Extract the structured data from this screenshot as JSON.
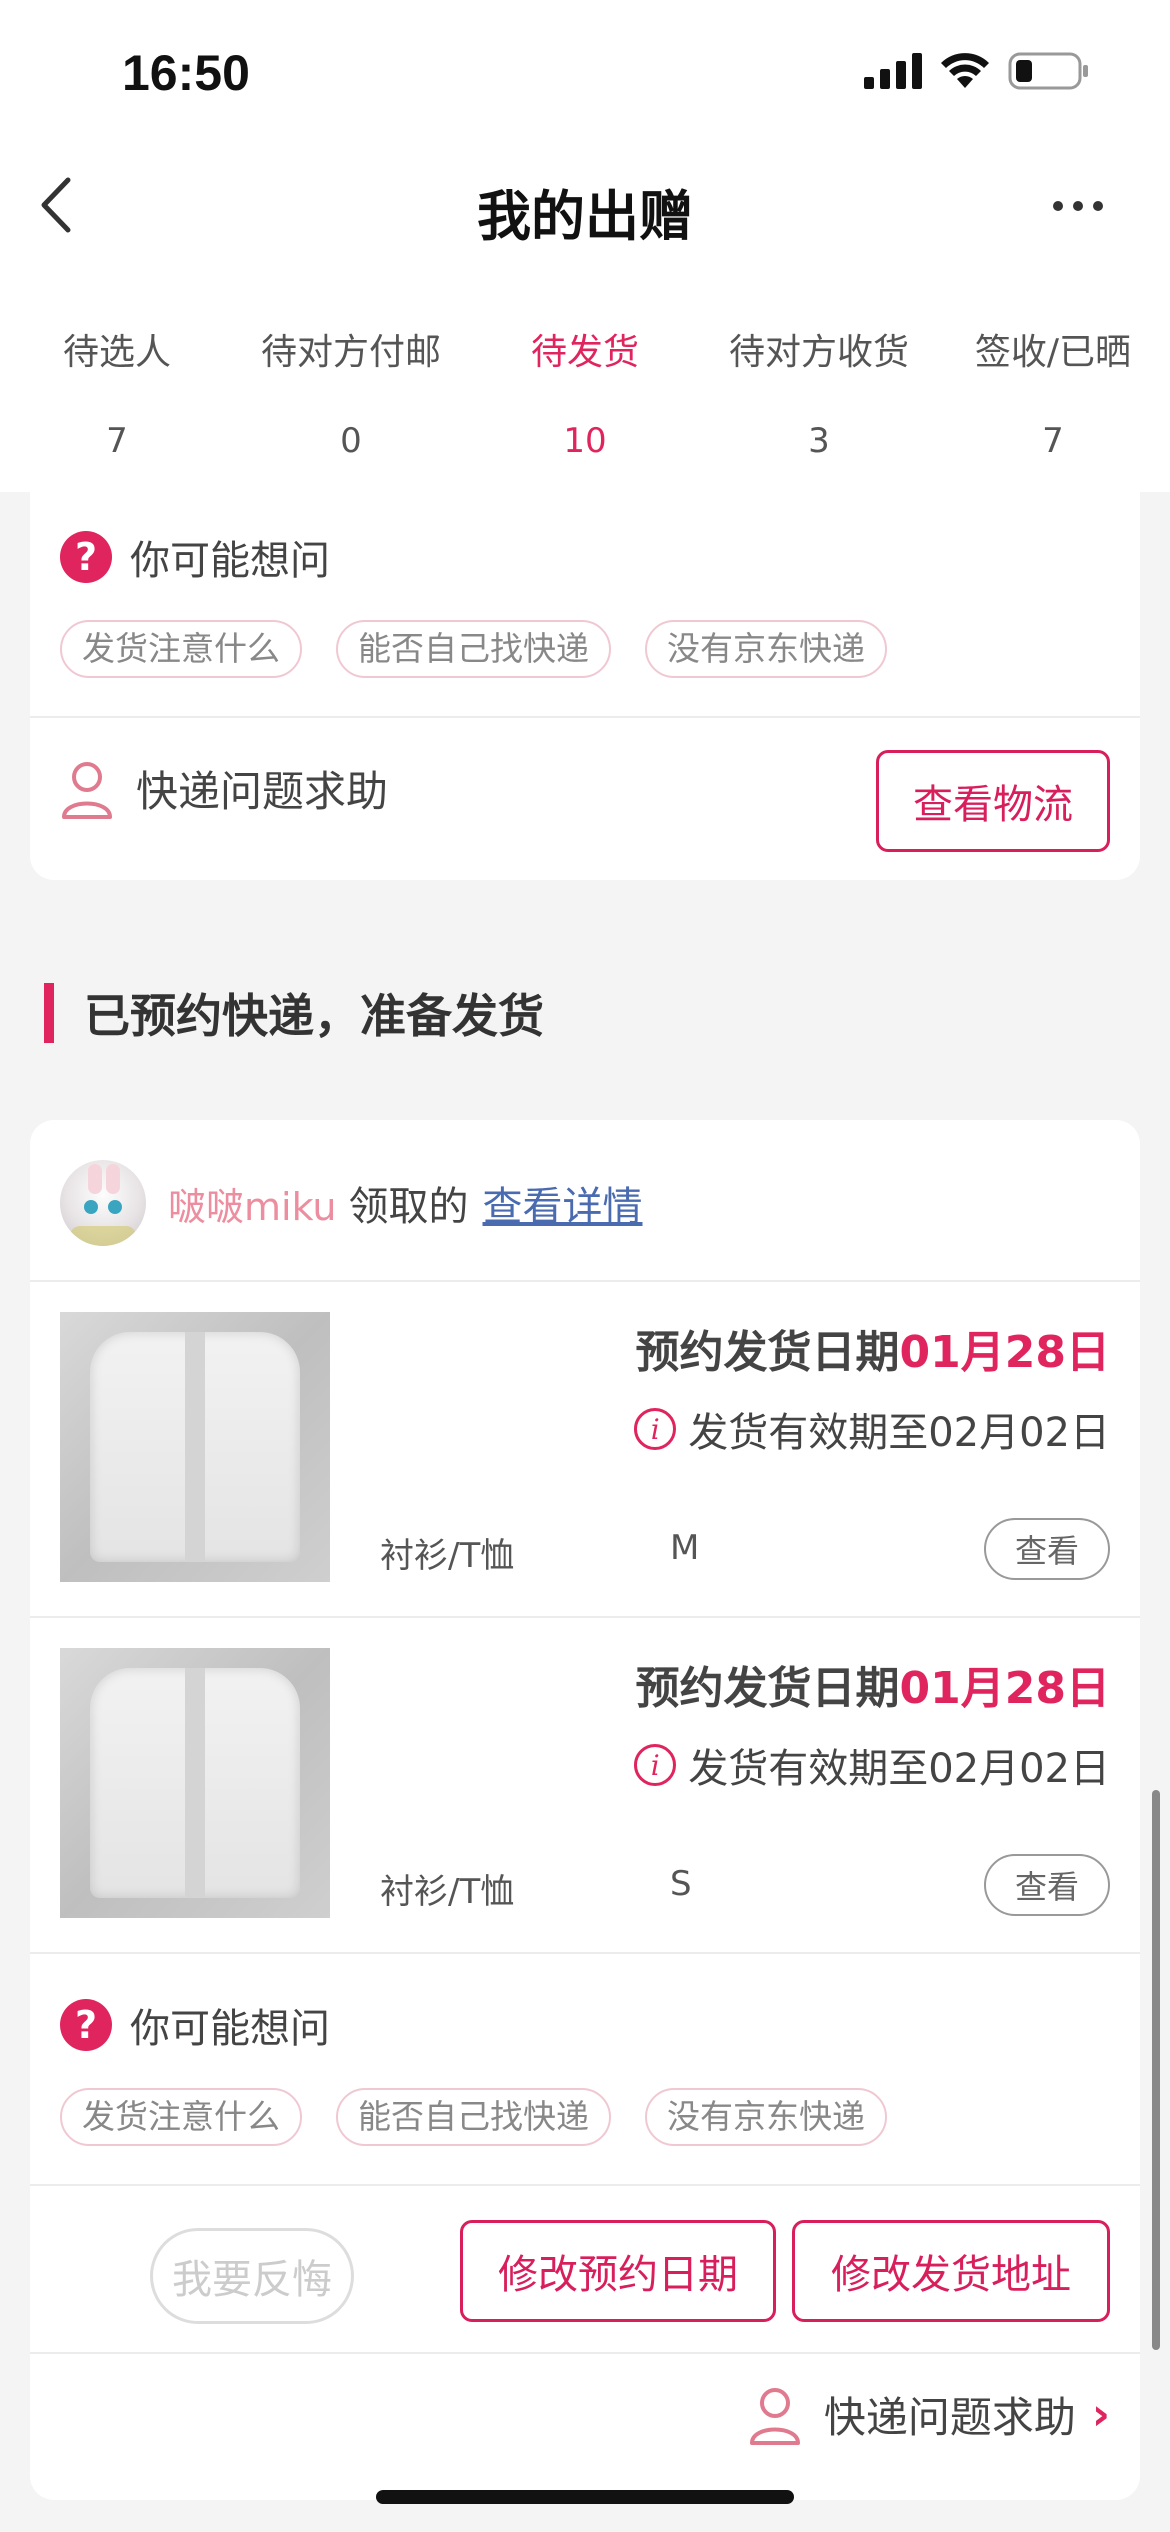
{
  "status_bar": {
    "time": "16:50"
  },
  "nav": {
    "title": "我的出赠"
  },
  "tabs": [
    {
      "label": "待选人",
      "count": "7"
    },
    {
      "label": "待对方付邮",
      "count": "0"
    },
    {
      "label": "待发货",
      "count": "10",
      "active": true
    },
    {
      "label": "待对方收货",
      "count": "3"
    },
    {
      "label": "签收/已晒",
      "count": "7"
    }
  ],
  "card1": {
    "question_title": "你可能想问",
    "chips": [
      "发货注意什么",
      "能否自己找快递",
      "没有京东快递"
    ],
    "help_label": "快递问题求助",
    "logistics_button": "查看物流"
  },
  "section": {
    "title": "已预约快递，准备发货"
  },
  "card2": {
    "giver_name": "啵啵miku",
    "giver_text": "领取的",
    "detail_link": "查看详情",
    "items": [
      {
        "date_prefix": "预约发货日期",
        "date_value": "01月28日",
        "valid_text": "发货有效期至02月02日",
        "category": "衬衫/T恤",
        "size": "M",
        "view": "查看"
      },
      {
        "date_prefix": "预约发货日期",
        "date_value": "01月28日",
        "valid_text": "发货有效期至02月02日",
        "category": "衬衫/T恤",
        "size": "S",
        "view": "查看"
      }
    ],
    "question_title": "你可能想问",
    "chips": [
      "发货注意什么",
      "能否自己找快递",
      "没有京东快递"
    ],
    "regret_button": "我要反悔",
    "change_date_button": "修改预约日期",
    "change_address_button": "修改发货地址",
    "help_label": "快递问题求助"
  },
  "colors": {
    "accent": "#e0245e",
    "link": "#4a6bb0"
  }
}
